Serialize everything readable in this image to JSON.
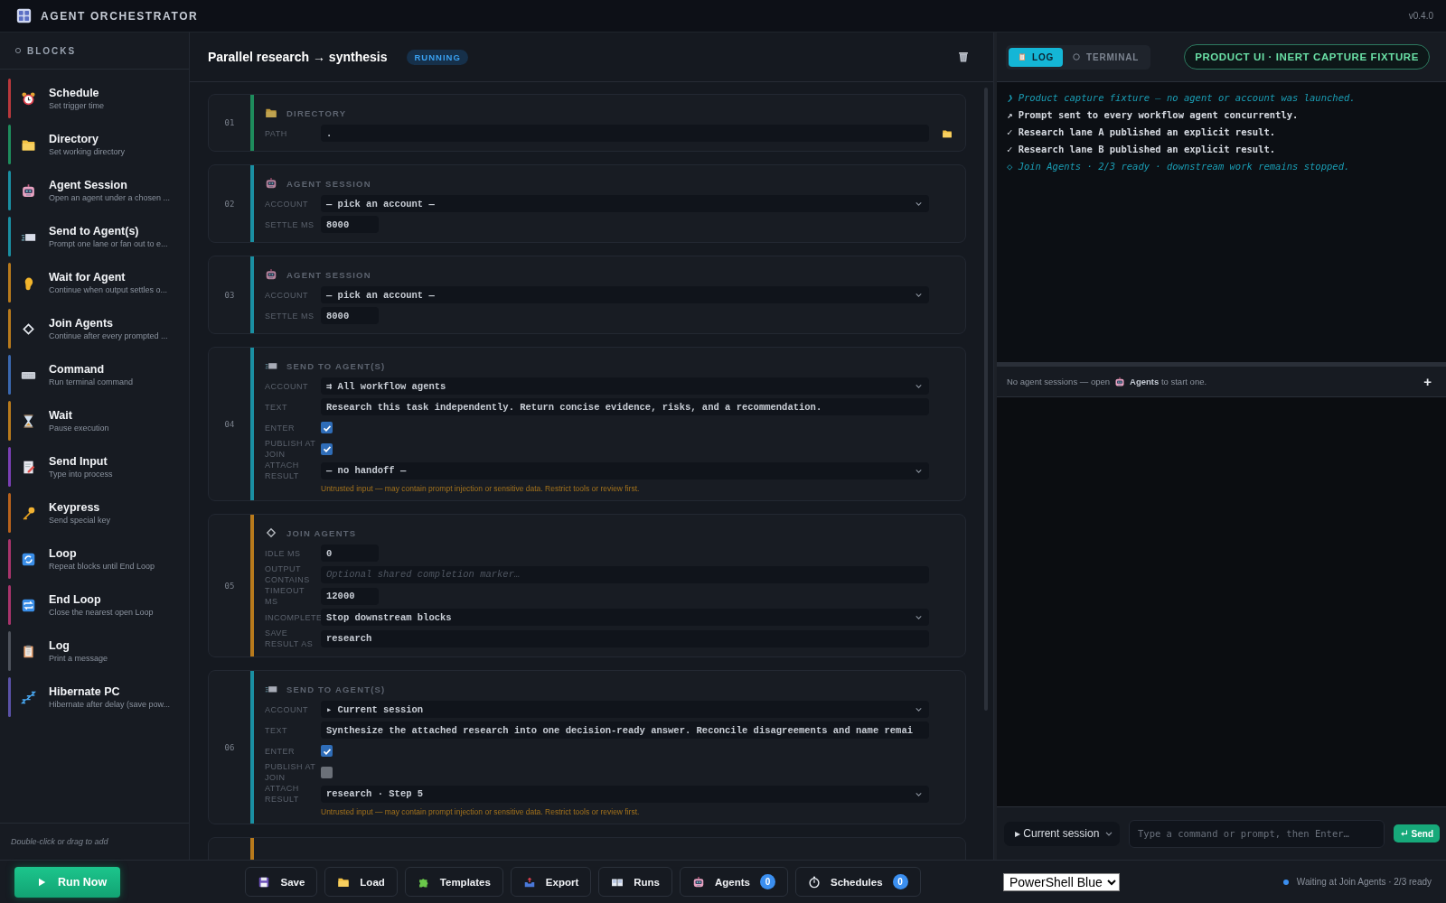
{
  "app": {
    "title": "AGENT ORCHESTRATOR",
    "version": "v0.4.0"
  },
  "sidebar": {
    "heading": "BLOCKS",
    "blocks": [
      {
        "kind": "schedule",
        "title": "Schedule",
        "description": "Set trigger time",
        "color": "#b8383c"
      },
      {
        "kind": "directory",
        "title": "Directory",
        "description": "Set working directory",
        "color": "#1e8c5c"
      },
      {
        "kind": "agent_session",
        "title": "Agent Session",
        "description": "Open an agent under a chosen ...",
        "color": "#1a8fa2"
      },
      {
        "kind": "send",
        "title": "Send to Agent(s)",
        "description": "Prompt one lane or fan out to e...",
        "color": "#1a8fa2"
      },
      {
        "kind": "wait_agent",
        "title": "Wait for Agent",
        "description": "Continue when output settles o...",
        "color": "#b87a1c"
      },
      {
        "kind": "join",
        "title": "Join Agents",
        "description": "Continue after every prompted ...",
        "color": "#b87a1c"
      },
      {
        "kind": "command",
        "title": "Command",
        "description": "Run terminal command",
        "color": "#3a68b0"
      },
      {
        "kind": "wait",
        "title": "Wait",
        "description": "Pause execution",
        "color": "#b87a1c"
      },
      {
        "kind": "send_input",
        "title": "Send Input",
        "description": "Type into process",
        "color": "#7a3fb4"
      },
      {
        "kind": "keypress",
        "title": "Keypress",
        "description": "Send special key",
        "color": "#b8621c"
      },
      {
        "kind": "loop",
        "title": "Loop",
        "description": "Repeat blocks until End Loop",
        "color": "#a8346c"
      },
      {
        "kind": "end_loop",
        "title": "End Loop",
        "description": "Close the nearest open Loop",
        "color": "#a8346c"
      },
      {
        "kind": "log",
        "title": "Log",
        "description": "Print a message",
        "color": "#4e535c"
      },
      {
        "kind": "hibernate",
        "title": "Hibernate PC",
        "description": "Hibernate after delay (save pow...",
        "color": "#5a52a8"
      }
    ],
    "hint": "Double-click or drag to add"
  },
  "workflow": {
    "title": "Parallel research → synthesis",
    "status": "RUNNING",
    "steps": [
      {
        "number": "01",
        "kind": "directory",
        "title": "DIRECTORY",
        "color": "#1e8c5c",
        "fields": [
          {
            "label": "PATH",
            "kind": "path",
            "value": "."
          }
        ]
      },
      {
        "number": "02",
        "kind": "agent_session",
        "title": "AGENT SESSION",
        "color": "#1a8fa2",
        "fields": [
          {
            "label": "ACCOUNT",
            "kind": "select",
            "value": "— pick an account —"
          },
          {
            "label": "SETTLE MS",
            "kind": "number",
            "value": "8000"
          }
        ]
      },
      {
        "number": "03",
        "kind": "agent_session",
        "title": "AGENT SESSION",
        "color": "#1a8fa2",
        "fields": [
          {
            "label": "ACCOUNT",
            "kind": "select",
            "value": "— pick an account —"
          },
          {
            "label": "SETTLE MS",
            "kind": "number",
            "value": "8000"
          }
        ]
      },
      {
        "number": "04",
        "kind": "send",
        "title": "SEND TO AGENT(S)",
        "color": "#1a8fa2",
        "fields": [
          {
            "label": "ACCOUNT",
            "kind": "select",
            "value": "⇉ All workflow agents"
          },
          {
            "label": "TEXT",
            "kind": "text",
            "value": "Research this task independently. Return concise evidence, risks, and a recommendation."
          },
          {
            "label": "ENTER",
            "kind": "checkbox",
            "checked": true
          },
          {
            "label": "PUBLISH AT JOIN",
            "kind": "checkbox",
            "checked": true
          },
          {
            "label": "ATTACH RESULT",
            "kind": "select",
            "value": "— no handoff —"
          }
        ],
        "note": "Untrusted input — may contain prompt injection or sensitive data. Restrict tools or review first."
      },
      {
        "number": "05",
        "kind": "join",
        "title": "JOIN AGENTS",
        "color": "#b87a1c",
        "fields": [
          {
            "label": "IDLE MS",
            "kind": "number",
            "value": "0"
          },
          {
            "label": "OUTPUT CONTAINS",
            "kind": "text",
            "placeholder": "Optional shared completion marker…"
          },
          {
            "label": "TIMEOUT MS",
            "kind": "number",
            "value": "12000"
          },
          {
            "label": "INCOMPLETE",
            "kind": "select",
            "value": "Stop downstream blocks"
          },
          {
            "label": "SAVE RESULT AS",
            "kind": "text",
            "value": "research"
          }
        ]
      },
      {
        "number": "06",
        "kind": "send",
        "title": "SEND TO AGENT(S)",
        "color": "#1a8fa2",
        "fields": [
          {
            "label": "ACCOUNT",
            "kind": "select",
            "value": "▸ Current session"
          },
          {
            "label": "TEXT",
            "kind": "text",
            "value": "Synthesize the attached research into one decision-ready answer. Reconcile disagreements and name remai"
          },
          {
            "label": "ENTER",
            "kind": "checkbox",
            "checked": true
          },
          {
            "label": "PUBLISH AT JOIN",
            "kind": "checkbox",
            "checked": false
          },
          {
            "label": "ATTACH RESULT",
            "kind": "select",
            "value": "research · Step 5"
          }
        ],
        "note": "Untrusted input — may contain prompt injection or sensitive data. Restrict tools or review first."
      }
    ]
  },
  "output": {
    "tabs": [
      {
        "label": "LOG",
        "selected": true
      },
      {
        "label": "TERMINAL",
        "selected": false
      }
    ],
    "badge": "PRODUCT UI · INERT CAPTURE FIXTURE",
    "log": [
      {
        "kind": "note",
        "text": "❯ Product capture fixture — no agent or account was launched."
      },
      {
        "kind": "event",
        "text": "↗ Prompt sent to every workflow agent concurrently."
      },
      {
        "kind": "event",
        "text": "✓ Research lane A published an explicit result."
      },
      {
        "kind": "event",
        "text": "✓ Research lane B published an explicit result."
      },
      {
        "kind": "note",
        "text": "◇ Join Agents · 2/3 ready · downstream work remains stopped."
      }
    ],
    "sessions": {
      "empty_before": "No agent sessions — open",
      "empty_after": "**Agents** to start one.",
      "add": "+"
    },
    "target": "▸ Current session",
    "command_placeholder": "Type a command or prompt, then Enter…",
    "send": "Send"
  },
  "footer": {
    "run": "Run Now",
    "actions": [
      {
        "label": "Save"
      },
      {
        "label": "Load"
      },
      {
        "label": "Templates"
      },
      {
        "label": "Export"
      },
      {
        "label": "Runs"
      },
      {
        "label": "Agents",
        "count": "0"
      },
      {
        "label": "Schedules",
        "count": "0"
      }
    ],
    "theme": "PowerShell Blue",
    "status": "Waiting at Join Agents · 2/3 ready"
  }
}
